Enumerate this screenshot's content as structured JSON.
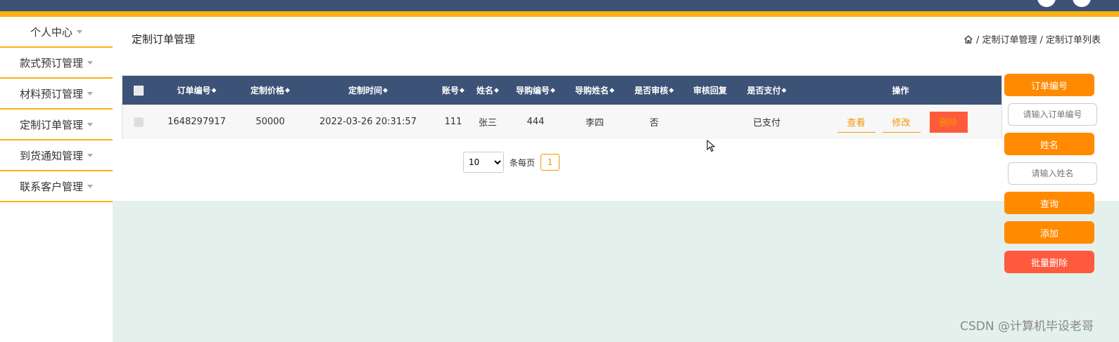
{
  "sidebar": {
    "items": [
      {
        "label": "个人中心"
      },
      {
        "label": "款式预订管理"
      },
      {
        "label": "材料预订管理"
      },
      {
        "label": "定制订单管理"
      },
      {
        "label": "到货通知管理"
      },
      {
        "label": "联系客户管理"
      }
    ]
  },
  "page": {
    "title": "定制订单管理",
    "breadcrumb": [
      "/ 定制订单管理",
      "/ 定制订单列表"
    ]
  },
  "table": {
    "headers": [
      "订单编号",
      "定制价格",
      "定制时间",
      "账号",
      "姓名",
      "导购编号",
      "导购姓名",
      "是否审核",
      "审核回复",
      "是否支付",
      "操作"
    ],
    "sortable_marker": "◆",
    "rows": [
      {
        "order_no": "1648297917",
        "price": "50000",
        "time": "2022-03-26 20:31:57",
        "account": "111",
        "name": "张三",
        "guide_no": "444",
        "guide_name": "李四",
        "reviewed": "否",
        "review_reply": "",
        "paid": "已支付"
      }
    ],
    "actions": {
      "view": "查看",
      "edit": "修改",
      "delete": "删除"
    }
  },
  "pager": {
    "page_size": "10",
    "page_size_options": [
      "10"
    ],
    "per_page_label": "条每页",
    "current_page": "1"
  },
  "search": {
    "order_no_label": "订单编号",
    "order_no_placeholder": "请输入订单编号",
    "name_label": "姓名",
    "name_placeholder": "请输入姓名",
    "query": "查询",
    "add": "添加",
    "batch_delete": "批量删除"
  },
  "watermark": "CSDN @计算机毕设老哥",
  "colors": {
    "header": "#3d5277",
    "accent": "#fbb014",
    "button": "#ff8a00",
    "danger": "#ff5a3d"
  }
}
